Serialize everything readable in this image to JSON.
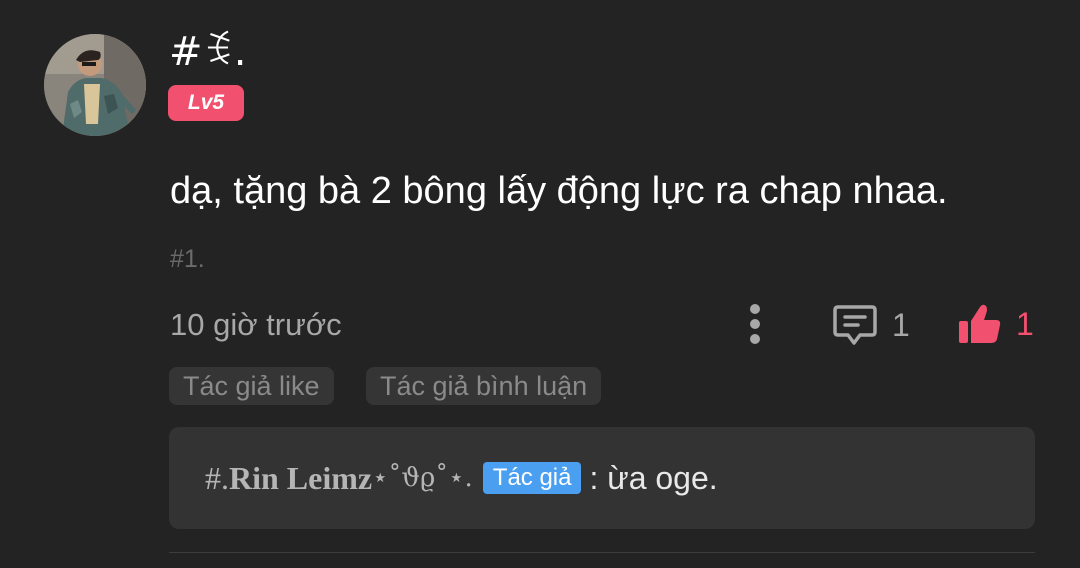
{
  "comment": {
    "user": {
      "name": "#ꉂ.",
      "level": "Lv5",
      "avatar": "user-avatar-photo"
    },
    "text": "dạ, tặng bà 2 bông lấy động lực ra chap nhaa.",
    "tag": "#1.",
    "timestamp": "10 giờ trước",
    "reply_count": "1",
    "like_count": "1"
  },
  "chips": {
    "author_like": "Tác giả like",
    "author_reply": "Tác giả bình luận"
  },
  "reply": {
    "author_prefix": "#.",
    "author_name": "Rin Leimz",
    "author_decoration": " ⋆˚ϑϱ˚⋆.",
    "author_badge": "Tác giả",
    "text": ": ừa oge."
  },
  "colors": {
    "background": "#232323",
    "accent_pink": "#f1506f",
    "author_badge_blue": "#4a9ff0",
    "muted_text": "#a8a8a8"
  },
  "icons": {
    "more": "more-vertical-icon",
    "reply": "comment-icon",
    "like": "thumbs-up-icon"
  }
}
